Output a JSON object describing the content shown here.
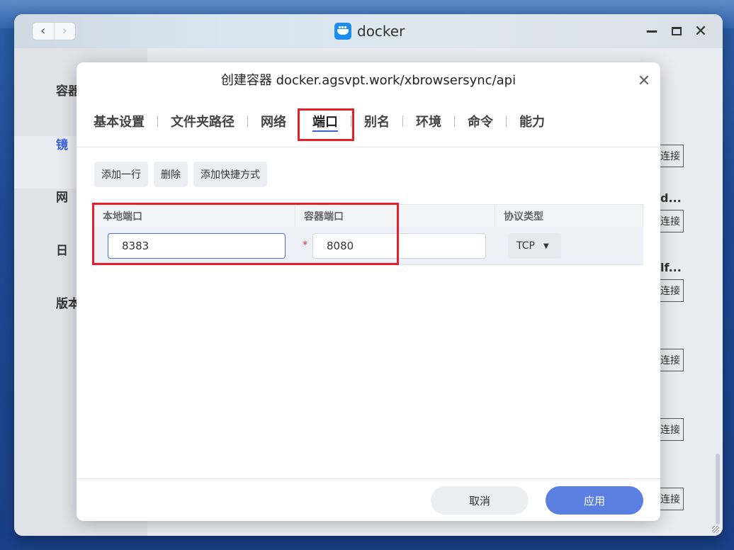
{
  "app": {
    "name": "docker",
    "accent": "#1d8ded"
  },
  "window_controls": {
    "back_icon": "chevron-left",
    "forward_icon": "chevron-right"
  },
  "sidebar": {
    "items": [
      {
        "label": "容器"
      },
      {
        "label": "镜"
      },
      {
        "label": "网"
      },
      {
        "label": "日"
      },
      {
        "label": "版本"
      }
    ]
  },
  "background_cards": [
    {
      "name": "",
      "button": "连接"
    },
    {
      "name": "d...",
      "button": "连接"
    },
    {
      "name": "lf...",
      "button": "连接"
    },
    {
      "name": "",
      "button": "连接"
    },
    {
      "name": "",
      "button": "连接"
    },
    {
      "name": "",
      "button": "连接"
    }
  ],
  "modal": {
    "title": "创建容器 docker.agsvpt.work/xbrowsersync/api",
    "tabs": [
      {
        "label": "基本设置",
        "active": false
      },
      {
        "label": "文件夹路径",
        "active": false
      },
      {
        "label": "网络",
        "active": false
      },
      {
        "label": "端口",
        "active": true
      },
      {
        "label": "别名",
        "active": false
      },
      {
        "label": "环境",
        "active": false
      },
      {
        "label": "命令",
        "active": false
      },
      {
        "label": "能力",
        "active": false
      }
    ],
    "toolbar": {
      "add_row": "添加一行",
      "delete": "删除",
      "add_shortcut": "添加快捷方式"
    },
    "table": {
      "headers": {
        "local_port": "本地端口",
        "container_port": "容器端口",
        "protocol": "协议类型"
      },
      "rows": [
        {
          "local_port": "8383",
          "container_port": "8080",
          "protocol": "TCP"
        }
      ]
    },
    "footer": {
      "cancel": "取消",
      "apply": "应用"
    },
    "highlight_color": "#e5202a",
    "primary_color": "#5a7fe0"
  }
}
